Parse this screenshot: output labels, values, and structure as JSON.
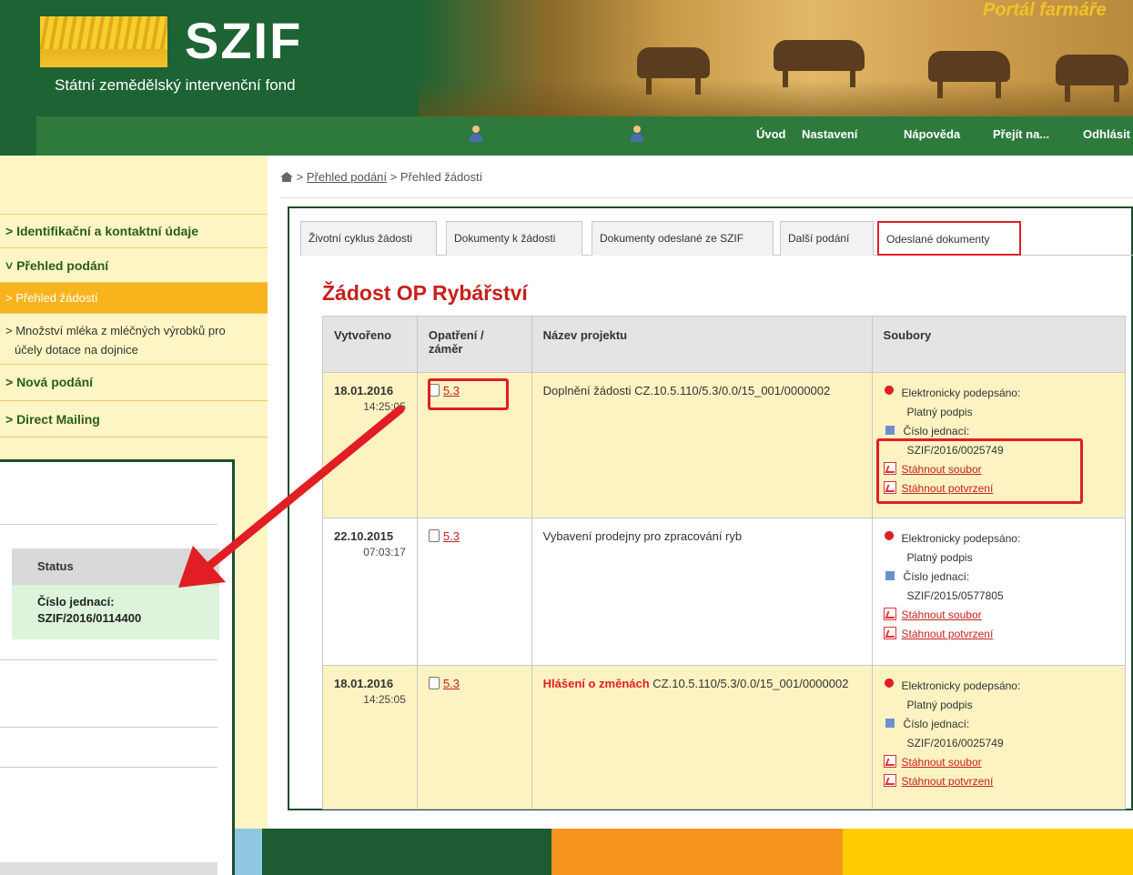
{
  "header": {
    "logo_text": "SZIF",
    "logo_subtitle": "Státní zemědělský intervenční fond",
    "portal_title": "Portál farmáře"
  },
  "nav": {
    "items": [
      "Úvod",
      "Nastavení",
      "Nápověda",
      "Přejít na...",
      "Odhlásit"
    ]
  },
  "breadcrumb": {
    "link": "Přehled podání",
    "separator": ">",
    "current": "Přehled žádostí"
  },
  "sidebar": {
    "items": [
      "> Identifikační a kontaktní údaje",
      "˅ Přehled podání",
      "> Přehled žádostí",
      "> Množství mléka z mléčných výrobků pro",
      "účely dotace na dojnice",
      "> Nová podání",
      "> Direct Mailing"
    ]
  },
  "tabs": [
    "Životní cyklus žádosti",
    "Dokumenty k žádosti",
    "Dokumenty odeslané ze SZIF",
    "Další podání",
    "Odeslané dokumenty"
  ],
  "heading": "Žádost OP Rybářství",
  "table": {
    "headers": [
      "Vytvořeno",
      "Opatření / záměr",
      "Název projektu",
      "Soubory"
    ],
    "rows": [
      {
        "date": "18.01.2016",
        "time": "14:25:05",
        "measure": "5.3",
        "prefix": "",
        "project": "Doplnění žádosti CZ.10.5.110/5.3/0.0/15_001/0000002",
        "signed": "Elektronicky podepsáno:",
        "valid": "Platný podpis",
        "ref_label": "Číslo jednací:",
        "ref": "SZIF/2016/0025749",
        "download_file": "Stáhnout soubor",
        "download_confirm": "Stáhnout potvrzení"
      },
      {
        "date": "22.10.2015",
        "time": "07:03:17",
        "measure": "5.3",
        "prefix": "",
        "project": "Vybavení prodejny pro zpracování ryb",
        "signed": "Elektronicky podepsáno:",
        "valid": "Platný podpis",
        "ref_label": "Číslo jednací:",
        "ref": "SZIF/2015/0577805",
        "download_file": "Stáhnout soubor",
        "download_confirm": "Stáhnout potvrzení"
      },
      {
        "date": "18.01.2016",
        "time": "14:25:05",
        "measure": "5.3",
        "prefix": "Hlášení o změnách",
        "project": "CZ.10.5.110/5.3/0.0/15_001/0000002",
        "signed": "Elektronicky podepsáno:",
        "valid": "Platný podpis",
        "ref_label": "Číslo jednací:",
        "ref": "SZIF/2016/0025749",
        "download_file": "Stáhnout soubor",
        "download_confirm": "Stáhnout potvrzení"
      }
    ]
  },
  "inset": {
    "status_header": "Status",
    "ref_label": "Číslo jednací:",
    "ref_value": "SZIF/2016/0114400"
  },
  "colors": {
    "header_green": "#1e6333",
    "nav_green": "#2d7a3c",
    "sidebar_yellow": "#fdf6c4",
    "active_orange": "#f9b41d",
    "accent_red": "#c6201c",
    "highlight_red": "#e01e24",
    "footer": [
      "#1e5a32",
      "#f7941d",
      "#ffcc00"
    ]
  }
}
